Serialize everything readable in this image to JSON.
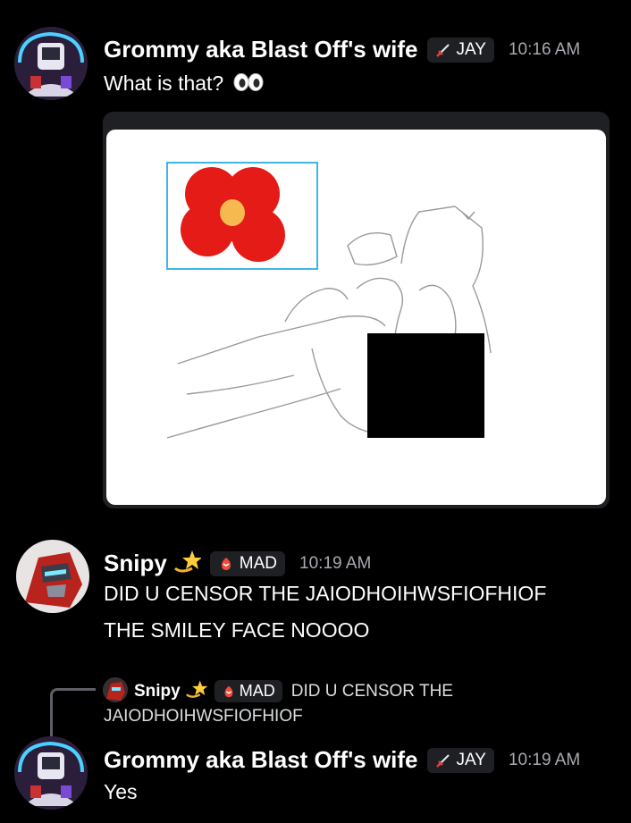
{
  "messages": [
    {
      "username": "Grommy aka Blast Off's wife",
      "tag": "JAY",
      "time": "10:16 AM",
      "text": "What is that?",
      "emoji": "eyes-emoji"
    },
    {
      "username": "Snipy",
      "tag": "MAD",
      "time": "10:19 AM",
      "lines": [
        "DID U CENSOR THE JAIODHOIHWSFIOFHIOF",
        "THE SMILEY FACE NOOOO"
      ]
    },
    {
      "reply": {
        "username": "Snipy",
        "tag": "MAD",
        "text_line1": "DID U CENSOR THE",
        "text_line2": "JAIODHOIHWSFIOFHIOF"
      },
      "username": "Grommy aka Blast Off's wife",
      "tag": "JAY",
      "time": "10:19 AM",
      "text": "Yes"
    }
  ],
  "icons": {
    "jay_tag": "sword-icon",
    "mad_tag": "anger-icon",
    "sparkle": "dizzy-star-emoji"
  },
  "colors": {
    "background": "#000000",
    "tag_bg": "#1f2024",
    "timestamp": "#a8a9b1"
  }
}
